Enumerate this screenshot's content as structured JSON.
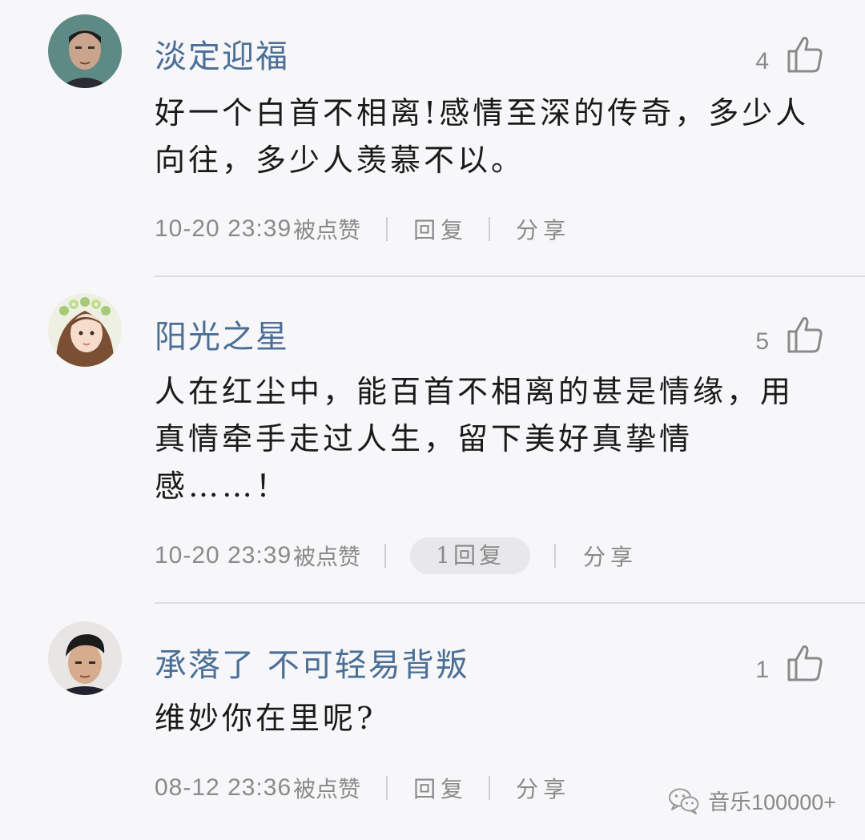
{
  "comments": [
    {
      "username": "淡定迎福",
      "likes": "4",
      "lines": [
        "好一个白首不相离!感情至深的传奇，多少人",
        "向往，多少人羡慕不以。"
      ],
      "time": "10-20 23:39",
      "liked_label": "被点赞",
      "reply_label": "回复",
      "share_label": "分享"
    },
    {
      "username": "阳光之星",
      "likes": "5",
      "lines": [
        "人在红尘中，能百首不相离的甚是情缘，用",
        "真情牵手走过人生，留下美好真挚情",
        "感……！"
      ],
      "time": "10-20 23:39",
      "liked_label": "被点赞",
      "reply_label": "1回复",
      "share_label": "分享"
    },
    {
      "username": "承落了 不可轻易背叛",
      "likes": "1",
      "lines": [
        "维妙你在里呢?"
      ],
      "time": "08-12 23:36",
      "liked_label": "被点赞",
      "reply_label": "回复",
      "share_label": "分享"
    }
  ],
  "watermark": {
    "text": "音乐100000+",
    "icon": "wechat-icon"
  },
  "colors": {
    "background": "#f7f6f8",
    "username": "#4b6f96",
    "meta": "#8a8a8a",
    "body": "#1a1a1a"
  }
}
